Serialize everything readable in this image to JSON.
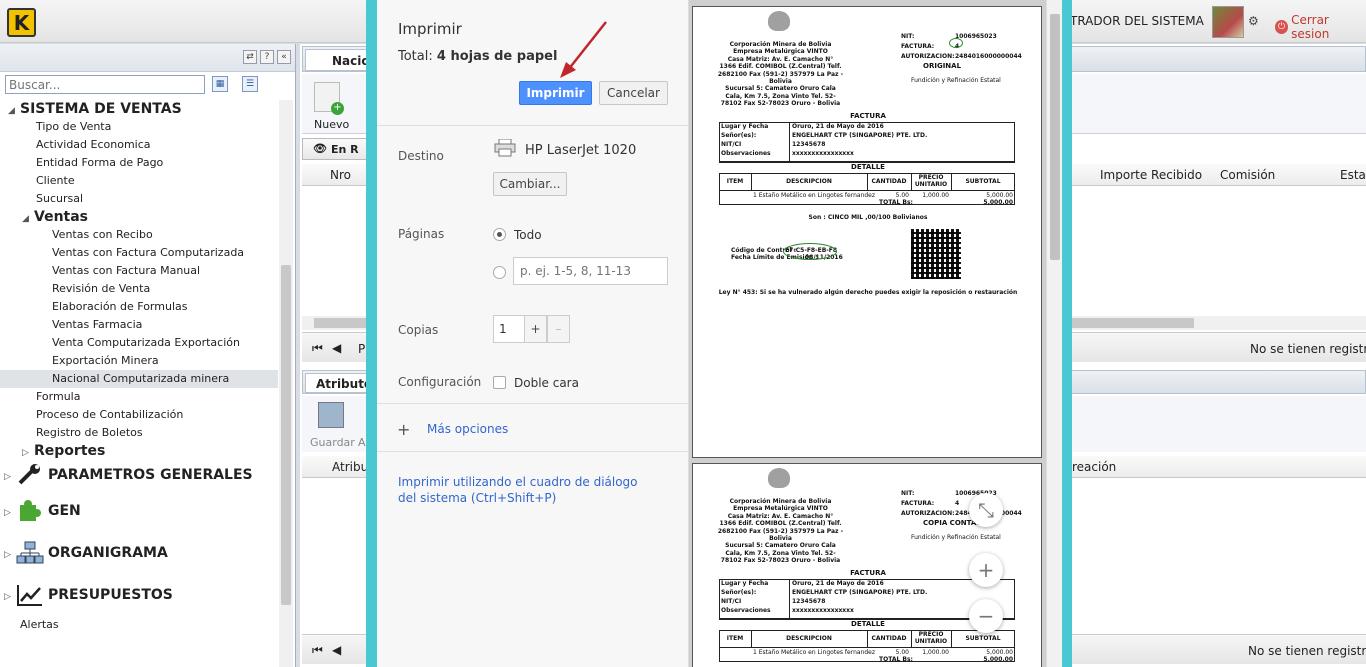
{
  "topbar": {
    "logo_letter": "K",
    "user_name": "TRADOR DEL SISTEMA",
    "logout_label": "Cerrar sesion"
  },
  "sidebar": {
    "search_placeholder": "Buscar...",
    "tree": [
      {
        "label": "SISTEMA DE VENTAS",
        "level": 0,
        "kind": "header"
      },
      {
        "label": "Tipo de Venta",
        "level": 1
      },
      {
        "label": "Actividad Economica",
        "level": 1
      },
      {
        "label": "Entidad Forma de Pago",
        "level": 1
      },
      {
        "label": "Cliente",
        "level": 1
      },
      {
        "label": "Sucursal",
        "level": 1
      },
      {
        "label": "Ventas",
        "level": 1,
        "kind": "header"
      },
      {
        "label": "Ventas con Recibo",
        "level": 2
      },
      {
        "label": "Ventas con Factura Computarizada",
        "level": 2
      },
      {
        "label": "Ventas con Factura Manual",
        "level": 2
      },
      {
        "label": "Revisión de Venta",
        "level": 2
      },
      {
        "label": "Elaboración de Formulas",
        "level": 2
      },
      {
        "label": "Ventas Farmacia",
        "level": 2
      },
      {
        "label": "Venta Computarizada Exportación",
        "level": 2
      },
      {
        "label": "Exportación Minera",
        "level": 2
      },
      {
        "label": "Nacional Computarizada minera",
        "level": 2,
        "selected": true
      },
      {
        "label": "Formula",
        "level": 1
      },
      {
        "label": "Proceso de Contabilización",
        "level": 1
      },
      {
        "label": "Registro de Boletos",
        "level": 1
      },
      {
        "label": "Reportes",
        "level": 1,
        "kind": "header"
      }
    ],
    "modules": [
      {
        "label": "PARAMETROS GENERALES",
        "icon": "wrench-icon"
      },
      {
        "label": "GEN",
        "icon": "puzzle-icon"
      },
      {
        "label": "ORGANIGRAMA",
        "icon": "org-chart-icon"
      },
      {
        "label": "PRESUPUESTOS",
        "icon": "line-chart-icon"
      }
    ],
    "alerts_label": "Alertas"
  },
  "main": {
    "tab_label": "Nacion",
    "nuevo_label": "Nuevo",
    "subtab_label": "En R",
    "grid_col_nro": "Nro",
    "grid_col_importe": "Importe Recibido",
    "grid_col_comision": "Comisión",
    "grid_col_esta": "Esta",
    "pager_p": "P",
    "no_records_1": "No se tienen registros",
    "attr_tab_label": "Atributos",
    "guardar_label": "Guardar",
    "guardar_extra": "A",
    "attr_col": "Atributo",
    "creacion_col": "reación",
    "no_records_2": "No se tienen registros"
  },
  "print_dialog": {
    "title": "Imprimir",
    "total_prefix": "Total: ",
    "total_value": "4 hojas de papel",
    "print_button": "Imprimir",
    "cancel_button": "Cancelar",
    "destination_label": "Destino",
    "printer_name": "HP LaserJet 1020",
    "change_button": "Cambiar...",
    "pages_label": "Páginas",
    "pages_all": "Todo",
    "pages_placeholder": "p. ej. 1-5, 8, 11-13",
    "copies_label": "Copias",
    "copies_value": "1",
    "copies_plus": "+",
    "copies_minus": "–",
    "settings_label": "Configuración",
    "duplex_label": "Doble cara",
    "more_options": "Más opciones",
    "system_dialog_link": "Imprimir utilizando el cuadro de diálogo del sistema (Ctrl+Shift+P)"
  },
  "invoice": {
    "company_lines": [
      "Corporación Minera de Bolivia",
      "Empresa Metalúrgica VINTO",
      "Casa Matriz: Av. E. Camacho N°",
      "1366 Edif. COMIBOL (Z.Central) Telf.",
      "2682100 Fax (591-2) 357979 La Paz -",
      "Bolivia",
      "Sucursal 5: Camatero Oruro Cala",
      "Cala, Km 7.5, Zona Vinto Tel. 52-",
      "78102 Fax 52-78023 Oruro - Bolivia"
    ],
    "nit_label": "NIT:",
    "nit_value": "1006965023",
    "factura_label": "FACTURA:",
    "factura_value": "4",
    "autorizacion_label": "AUTORIZACION:",
    "autorizacion_value": "2484016000000044",
    "original_label": "ORIGINAL",
    "copy_label": "COPIA CONTABILI",
    "activity": "Fundición y Refinación Estatal",
    "doc_title": "FACTURA",
    "rows": [
      {
        "label": "Lugar y Fecha",
        "value": "Oruro, 21 de Mayo de 2016"
      },
      {
        "label": "Señor(es):",
        "value": "ENGELHART CTP (SINGAPORE) PTE. LTD."
      },
      {
        "label": "NIT/CI",
        "value": "12345678"
      },
      {
        "label": "Observaciones",
        "value": "xxxxxxxxxxxxxxxx"
      }
    ],
    "detail_title": "DETALLE",
    "cols": [
      "ITEM",
      "DESCRIPCION",
      "CANTIDAD",
      "PRECIO UNITARIO",
      "SUBTOTAL"
    ],
    "item": {
      "desc": "1 Estaño Metálico en Lingotes fernandez",
      "qty": "5.00",
      "price": "1,000.00",
      "subtotal": "5,000.00"
    },
    "total_label": "TOTAL Bs:",
    "total_value": "5,000.00",
    "son": "Son : CINCO MIL ,00/100 Bolivianos",
    "control_label": "Código de Control :",
    "control_value": "E7-C5-F8-EB-F8",
    "limit_label": "Fecha Límite de Emisión :",
    "limit_value": "08/11/2016",
    "law": "Ley N° 453: Si se ha vulnerado algún derecho puedes exigir la reposición o restauración"
  }
}
